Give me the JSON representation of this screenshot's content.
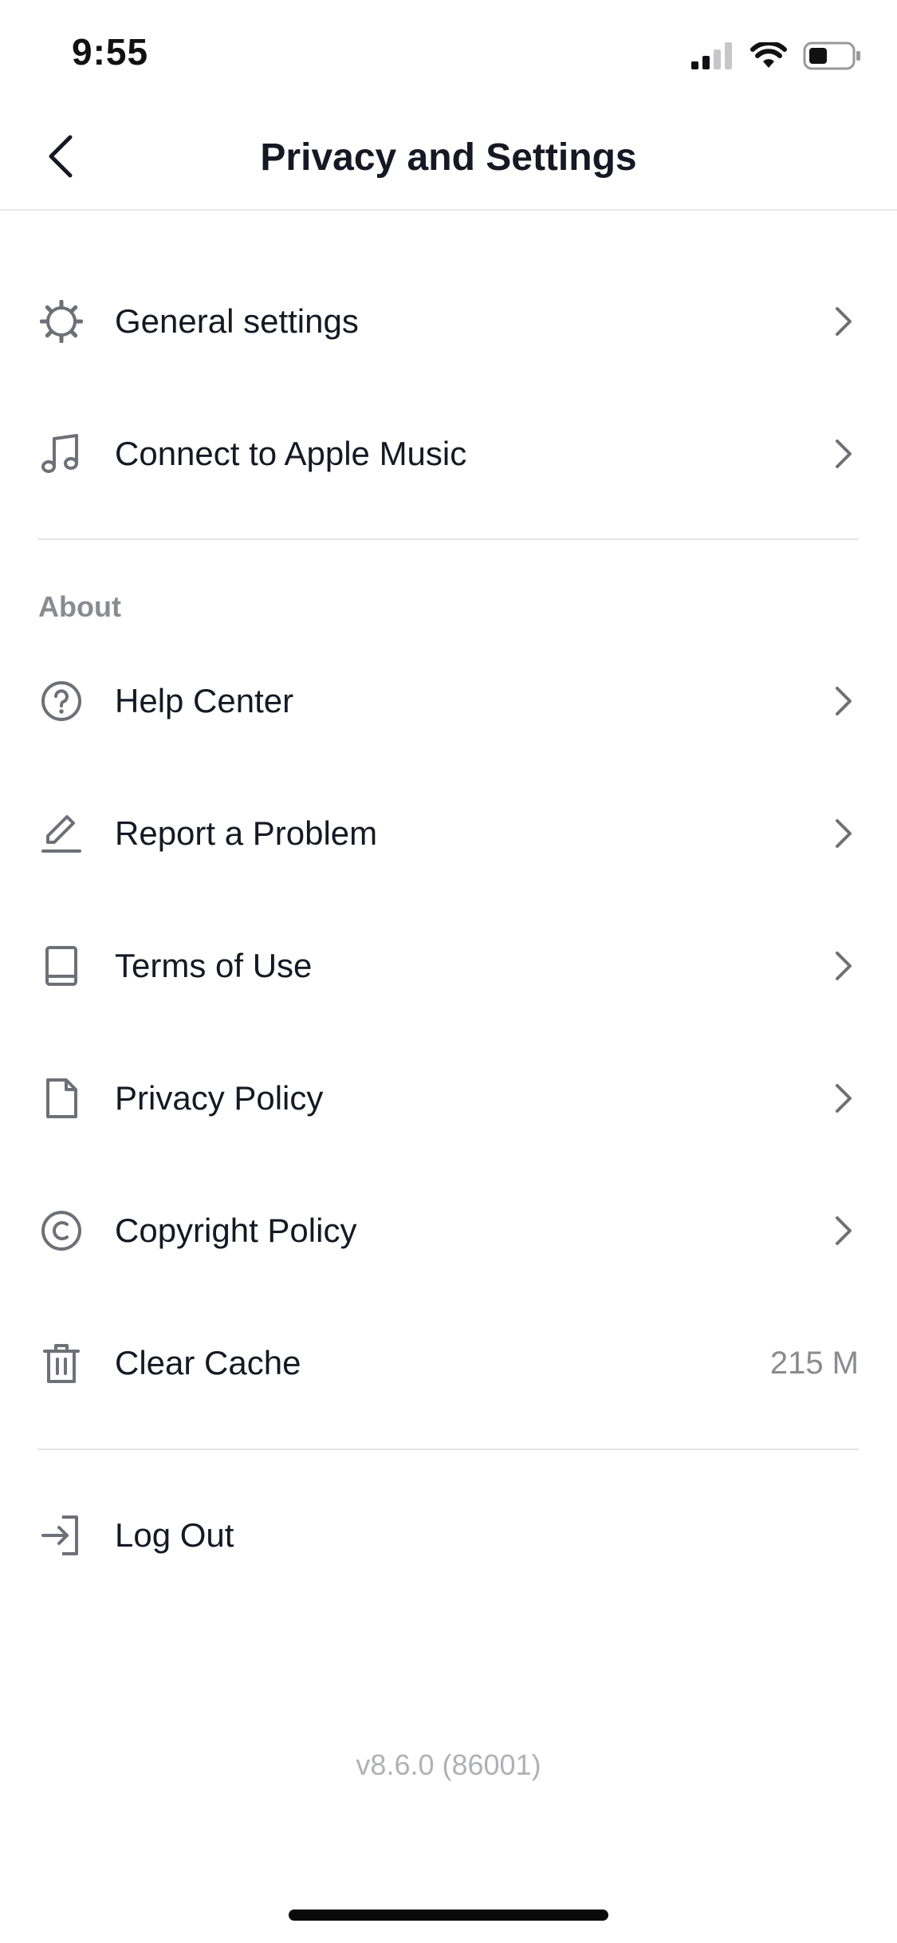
{
  "status": {
    "time": "9:55"
  },
  "header": {
    "title": "Privacy and Settings"
  },
  "settings_items": [
    {
      "label": "General settings",
      "icon": "gear-icon"
    },
    {
      "label": "Connect to Apple Music",
      "icon": "music-note-icon"
    }
  ],
  "about": {
    "header": "About",
    "items": [
      {
        "label": "Help Center",
        "icon": "question-circle-icon"
      },
      {
        "label": "Report a Problem",
        "icon": "pencil-icon"
      },
      {
        "label": "Terms of Use",
        "icon": "book-icon"
      },
      {
        "label": "Privacy Policy",
        "icon": "document-icon"
      },
      {
        "label": "Copyright Policy",
        "icon": "copyright-icon"
      }
    ],
    "clear_cache": {
      "label": "Clear Cache",
      "value": "215 M",
      "icon": "trash-icon"
    }
  },
  "logout": {
    "label": "Log Out",
    "icon": "logout-icon"
  },
  "version": "v8.6.0 (86001)",
  "colors": {
    "text": "#161823",
    "secondary": "#8a8b91",
    "icon": "#6f7077",
    "divider": "#e3e3e4"
  }
}
